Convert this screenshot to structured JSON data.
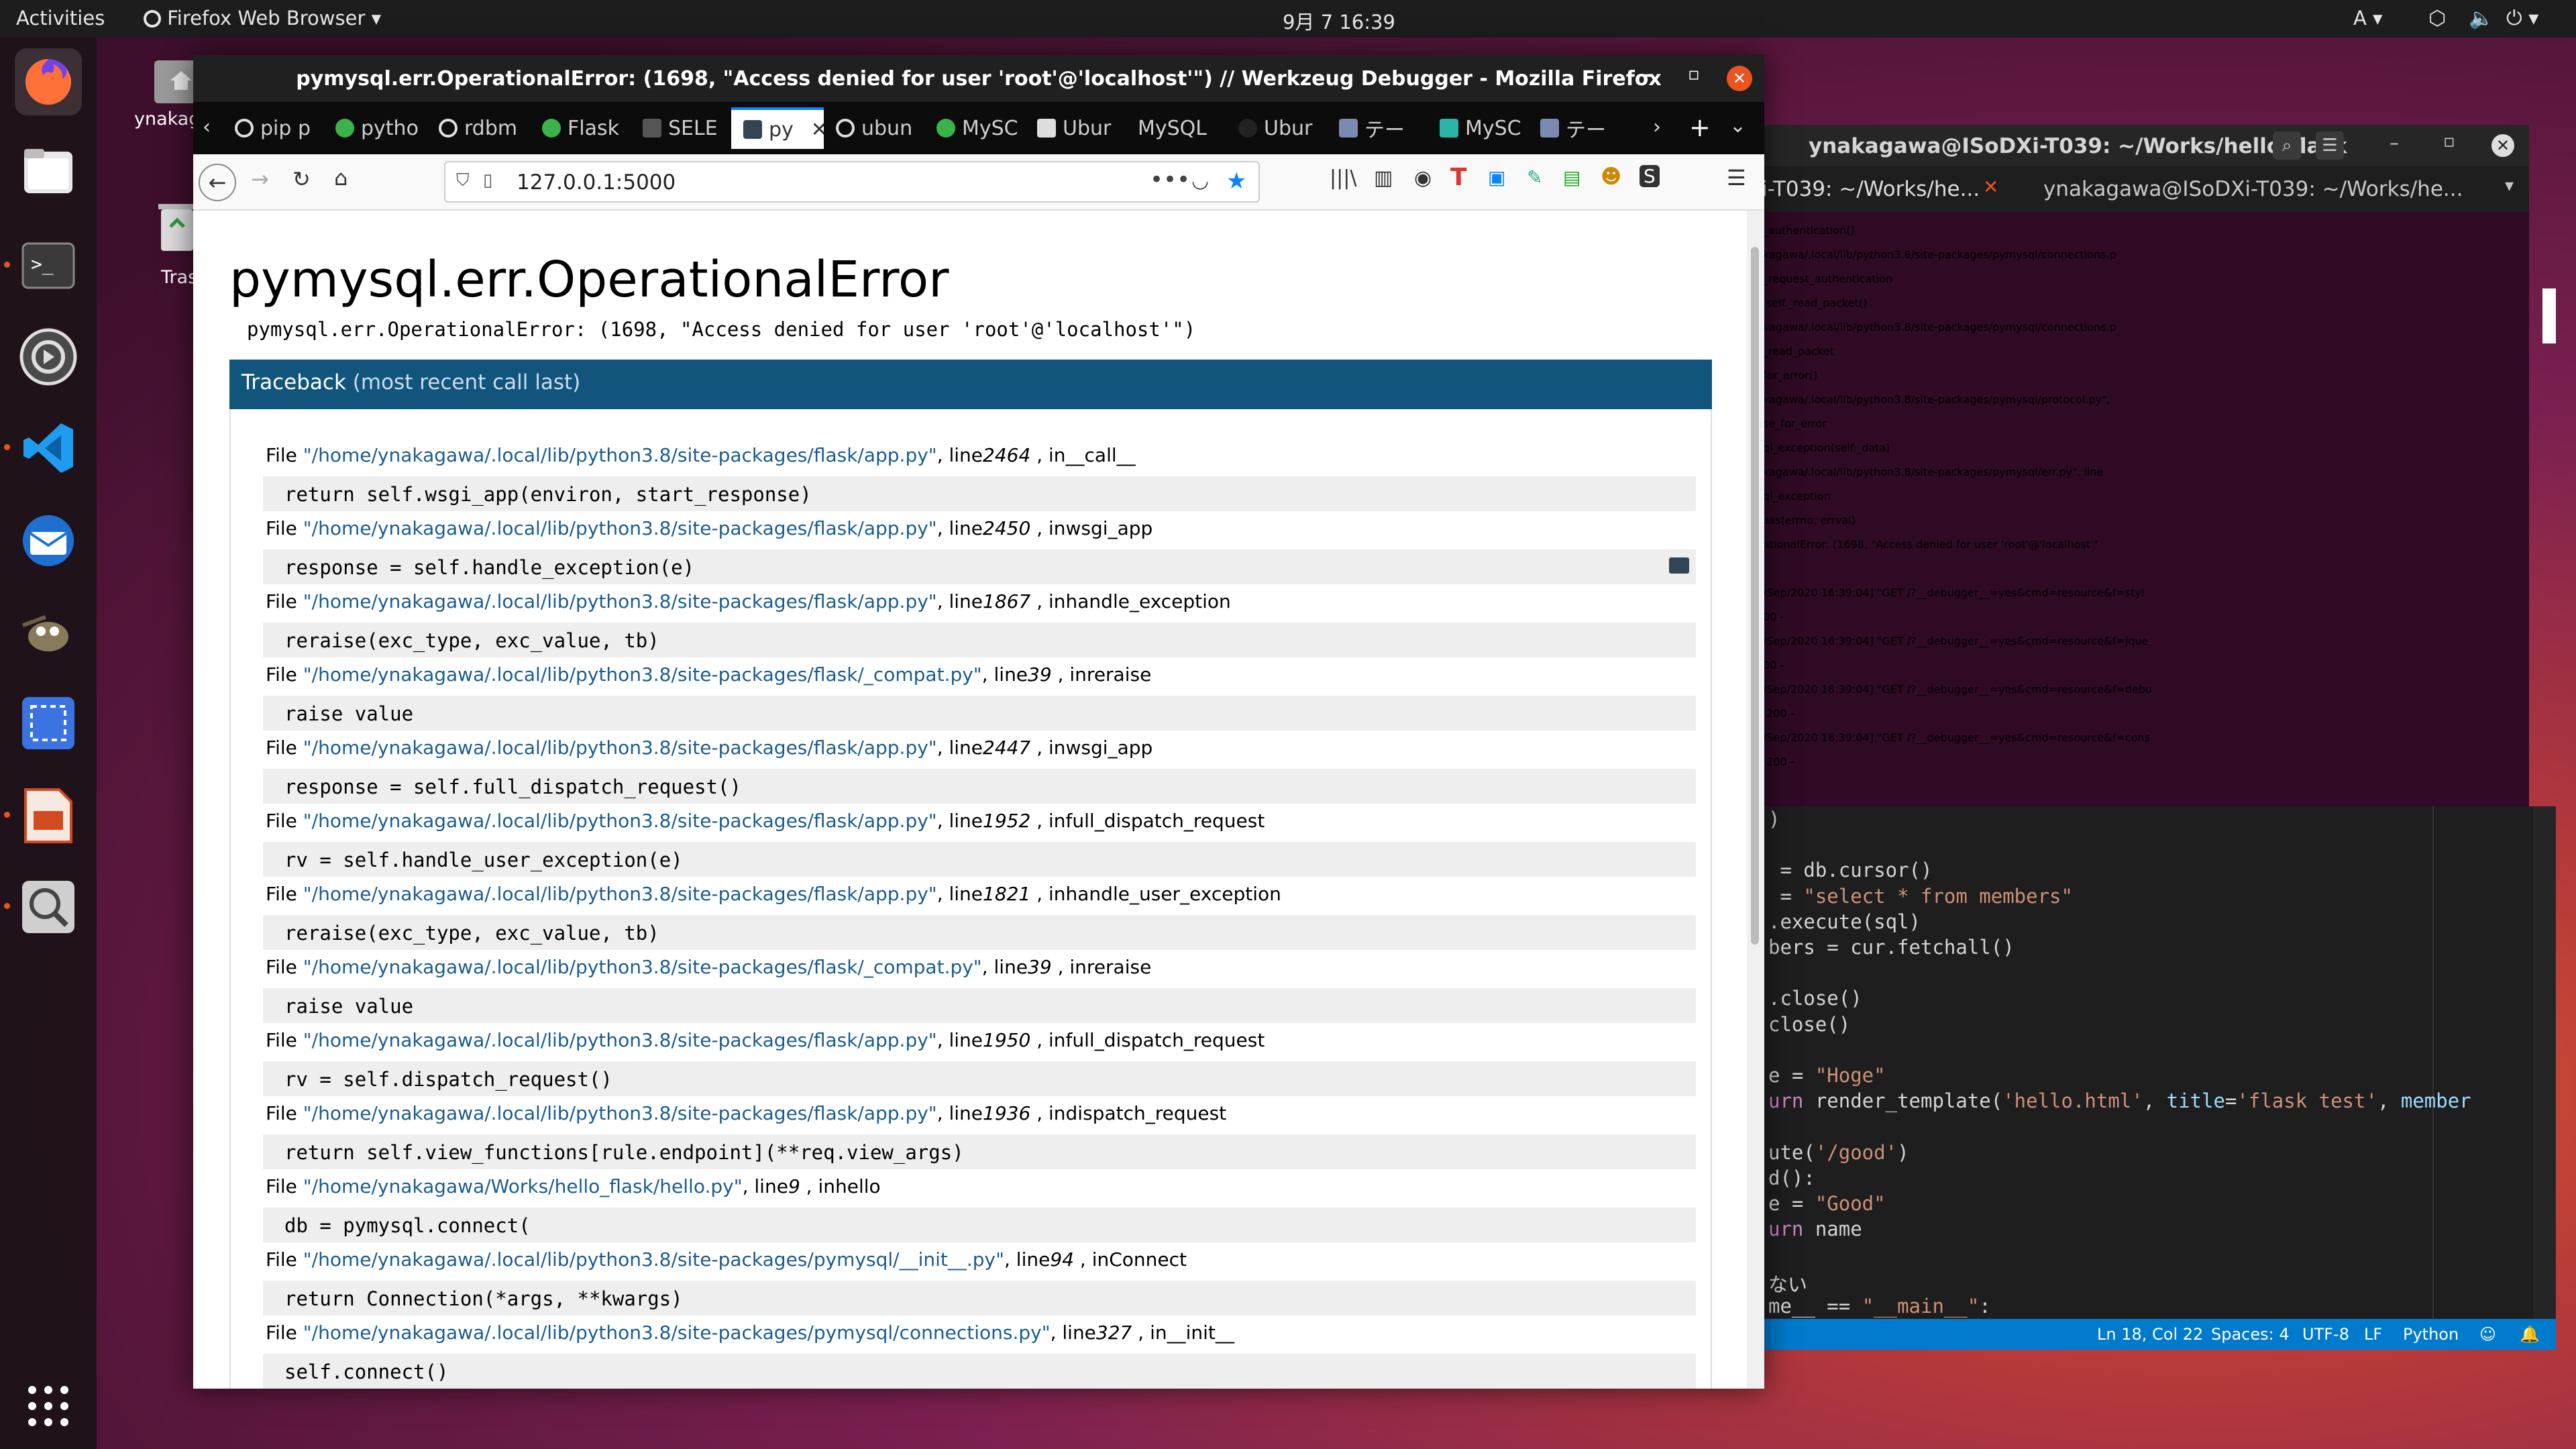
{
  "topbar": {
    "activities": "Activities",
    "app_name": "Firefox Web Browser",
    "clock": "9月 7  16:39",
    "input_method": "A"
  },
  "desktop": {
    "home_label": "ynakag",
    "trash_label": "Tras"
  },
  "firefox": {
    "window_title": "pymysql.err.OperationalError: (1698, \"Access denied for user 'root'@'localhost'\") // Werkzeug Debugger - Mozilla Firefox",
    "tabs": [
      {
        "label": "pip p"
      },
      {
        "label": "pytho"
      },
      {
        "label": "rdbm"
      },
      {
        "label": "Flask"
      },
      {
        "label": "SELE"
      },
      {
        "label": "py"
      },
      {
        "label": "ubun"
      },
      {
        "label": "MySC"
      },
      {
        "label": "Ubur"
      },
      {
        "label": "MySQL"
      },
      {
        "label": "Ubur"
      },
      {
        "label": "テー"
      },
      {
        "label": "MySC"
      },
      {
        "label": "テー"
      }
    ],
    "url": "127.0.0.1:5000",
    "page": {
      "heading": "pymysql.err.OperationalError",
      "message": "pymysql.err.OperationalError: (1698, \"Access denied for user 'root'@'localhost'\")",
      "traceback_label": "Traceback",
      "traceback_sub": "(most recent call last)",
      "file_word": "File",
      "line_word": ", line",
      "in_word": ", in",
      "frames": [
        {
          "path": "\"/home/ynakagawa/.local/lib/python3.8/site-packages/flask/app.py\"",
          "line": "2464",
          "func": "__call__",
          "code": "return self.wsgi_app(environ, start_response)"
        },
        {
          "path": "\"/home/ynakagawa/.local/lib/python3.8/site-packages/flask/app.py\"",
          "line": "2450",
          "func": "wsgi_app",
          "code": "response = self.handle_exception(e)"
        },
        {
          "path": "\"/home/ynakagawa/.local/lib/python3.8/site-packages/flask/app.py\"",
          "line": "1867",
          "func": "handle_exception",
          "code": "reraise(exc_type, exc_value, tb)"
        },
        {
          "path": "\"/home/ynakagawa/.local/lib/python3.8/site-packages/flask/_compat.py\"",
          "line": "39",
          "func": "reraise",
          "code": "raise value"
        },
        {
          "path": "\"/home/ynakagawa/.local/lib/python3.8/site-packages/flask/app.py\"",
          "line": "2447",
          "func": "wsgi_app",
          "code": "response = self.full_dispatch_request()"
        },
        {
          "path": "\"/home/ynakagawa/.local/lib/python3.8/site-packages/flask/app.py\"",
          "line": "1952",
          "func": "full_dispatch_request",
          "code": "rv = self.handle_user_exception(e)"
        },
        {
          "path": "\"/home/ynakagawa/.local/lib/python3.8/site-packages/flask/app.py\"",
          "line": "1821",
          "func": "handle_user_exception",
          "code": "reraise(exc_type, exc_value, tb)"
        },
        {
          "path": "\"/home/ynakagawa/.local/lib/python3.8/site-packages/flask/_compat.py\"",
          "line": "39",
          "func": "reraise",
          "code": "raise value"
        },
        {
          "path": "\"/home/ynakagawa/.local/lib/python3.8/site-packages/flask/app.py\"",
          "line": "1950",
          "func": "full_dispatch_request",
          "code": "rv = self.dispatch_request()"
        },
        {
          "path": "\"/home/ynakagawa/.local/lib/python3.8/site-packages/flask/app.py\"",
          "line": "1936",
          "func": "dispatch_request",
          "code": "return self.view_functions[rule.endpoint](**req.view_args)"
        },
        {
          "path": "\"/home/ynakagawa/Works/hello_flask/hello.py\"",
          "line": "9",
          "func": "hello",
          "code": "db = pymysql.connect("
        },
        {
          "path": "\"/home/ynakagawa/.local/lib/python3.8/site-packages/pymysql/__init__.py\"",
          "line": "94",
          "func": "Connect",
          "code": "return Connection(*args, **kwargs)"
        },
        {
          "path": "\"/home/ynakagawa/.local/lib/python3.8/site-packages/pymysql/connections.py\"",
          "line": "327",
          "func": "__init__",
          "code": "self.connect()"
        }
      ]
    }
  },
  "terminal": {
    "title": "ynakagawa@ISoDXi-T039: ~/Works/hello_flask",
    "tab1": "i-T039: ~/Works/he...",
    "tab2": "ynakagawa@ISoDXi-T039: ~/Works/he...",
    "lines": [
      "_authentication()",
      "kagawa/.local/lib/python3.8/site-packages/pymysql/connections.p",
      "_request_authentication",
      " self._read_packet()",
      "kagawa/.local/lib/python3.8/site-packages/pymysql/connections.p",
      "_read_packet",
      "for_error()",
      "kagawa/.local/lib/python3.8/site-packages/pymysql/protocol.py\",",
      "se_for_error",
      "ql_exception(self._data)",
      "kagawa/.local/lib/python3.8/site-packages/pymysql/err.py\", line",
      "ql_exception",
      "ass(errno, errval)",
      "ationalError: (1698, \"Access denied for user 'root'@'localhost'\"",
      "",
      "/Sep/2020 16:39:04] \"GET /?__debugger__=yes&cmd=resource&f=styl",
      "00 -",
      "/Sep/2020 16:39:04] \"GET /?__debugger__=yes&cmd=resource&f=jque",
      "00 -",
      "/Sep/2020 16:39:04] \"GET /?__debugger__=yes&cmd=resource&f=debu",
      " 200 -",
      "/Sep/2020 16:39:04] \"GET /?__debugger__=yes&cmd=resource&f=cons",
      " 200 -"
    ]
  },
  "vscode": {
    "lines": [
      ")",
      "",
      " = db.cursor()",
      " = \"select * from members\"",
      ".execute(sql)",
      "bers = cur.fetchall()",
      "",
      ".close()",
      "close()",
      "",
      "e = \"Hoge\"",
      "urn render_template('hello.html', title='flask test', member",
      "",
      "ute('/good')",
      "d():",
      "e = \"Good\"",
      "urn name",
      "",
      "ない",
      "me__ == \"__main__\":"
    ],
    "status": {
      "position": "Ln 18, Col 22",
      "spaces": "Spaces: 4",
      "encoding": "UTF-8",
      "eol": "LF",
      "language": "Python"
    }
  },
  "colors": {
    "traceback_header": "#11557c",
    "path_link": "#1a5c90",
    "terminal_bg": "#2f0a25",
    "vscode_status": "#007acc",
    "ubuntu_orange": "#e95420"
  }
}
